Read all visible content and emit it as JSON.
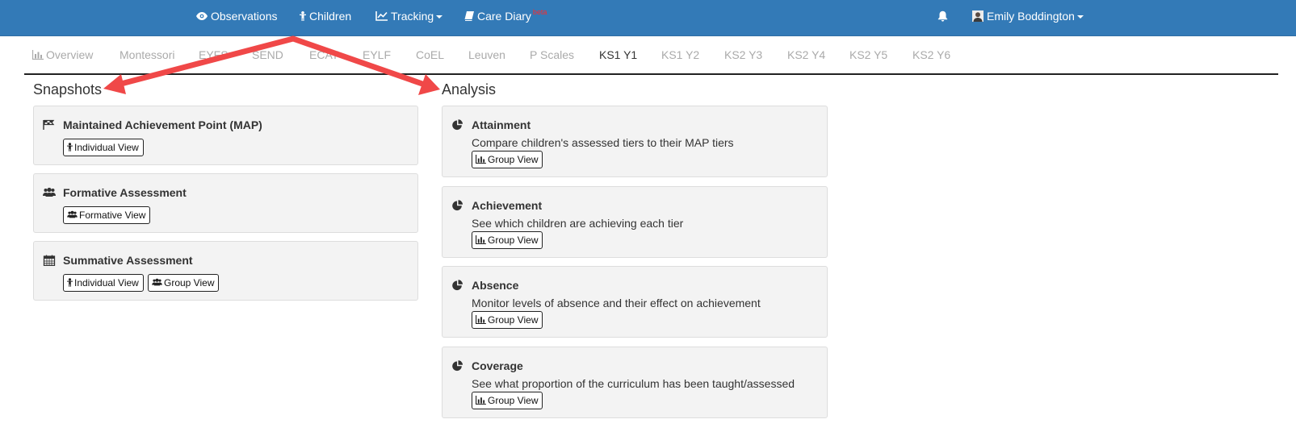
{
  "topnav": {
    "observations": "Observations",
    "children": "Children",
    "tracking": "Tracking",
    "care_diary": "Care Diary",
    "care_diary_badge": "beta",
    "user_name": "Emily Boddington"
  },
  "tabs": [
    {
      "label": "Overview",
      "active": false
    },
    {
      "label": "Montessori",
      "active": false
    },
    {
      "label": "EYFS",
      "active": false
    },
    {
      "label": "SEND",
      "active": false
    },
    {
      "label": "ECAT",
      "active": false
    },
    {
      "label": "EYLF",
      "active": false
    },
    {
      "label": "CoEL",
      "active": false
    },
    {
      "label": "Leuven",
      "active": false
    },
    {
      "label": "P Scales",
      "active": false
    },
    {
      "label": "KS1 Y1",
      "active": true
    },
    {
      "label": "KS1 Y2",
      "active": false
    },
    {
      "label": "KS2 Y3",
      "active": false
    },
    {
      "label": "KS2 Y4",
      "active": false
    },
    {
      "label": "KS2 Y5",
      "active": false
    },
    {
      "label": "KS2 Y6",
      "active": false
    }
  ],
  "snapshots": {
    "title": "Snapshots",
    "cards": [
      {
        "title": "Maintained Achievement Point (MAP)",
        "icon": "flag-icon",
        "buttons": [
          "Individual View"
        ]
      },
      {
        "title": "Formative Assessment",
        "icon": "users-icon",
        "buttons": [
          "Formative View"
        ]
      },
      {
        "title": "Summative Assessment",
        "icon": "calendar-icon",
        "buttons": [
          "Individual View",
          "Group View"
        ]
      }
    ]
  },
  "analysis": {
    "title": "Analysis",
    "cards": [
      {
        "title": "Attainment",
        "description": "Compare children's assessed tiers to their MAP tiers",
        "button": "Group View",
        "icon": "pie-chart-icon"
      },
      {
        "title": "Achievement",
        "description": "See which children are achieving each tier",
        "button": "Group View",
        "icon": "pie-chart-icon"
      },
      {
        "title": "Absence",
        "description": "Monitor levels of absence and their effect on achievement",
        "button": "Group View",
        "icon": "pie-chart-icon"
      },
      {
        "title": "Coverage",
        "description": "See what proportion of the curriculum has been taught/assessed",
        "button": "Group View",
        "icon": "pie-chart-icon"
      }
    ]
  },
  "colors": {
    "topbar": "#337ab7",
    "arrow": "#f04848",
    "beta": "#ff2a2a"
  }
}
